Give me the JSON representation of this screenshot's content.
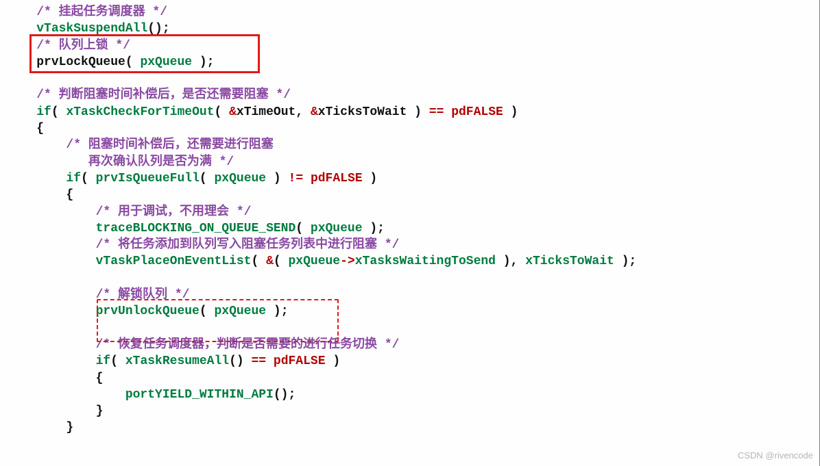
{
  "code": {
    "c1": "/* 挂起任务调度器 */",
    "fn1": "vTaskSuspendAll",
    "p1": "();",
    "c2": "/* 队列上锁 */",
    "ln4a": "prvLockQueue( ",
    "ln4b": "pxQueue",
    "ln4c": " );",
    "c3": "/* 判断阻塞时间补偿后，是否还需要阻塞 */",
    "if": "if",
    "fn2": "xTaskCheckForTimeOut",
    "ln7a": "( ",
    "ln7b": "( ",
    "ln7c": "&",
    "arg1": "xTimeOut",
    "ln7d": ", ",
    "ln7e": "&",
    "arg2": "xTicksToWait",
    "ln7f": " ) ",
    "eq": "==",
    "pdFALSE": "pdFALSE",
    "ln7g": " )",
    "lbrace": "{",
    "rbrace": "}",
    "c4a": "/* 阻塞时间补偿后，还需要进行阻塞",
    "c4b": "   再次确认队列是否为满 */",
    "fn3": "prvIsQueueFull",
    "ln11a": "( ",
    "ln11b": "( ",
    "pxQueue": "pxQueue",
    "ln11c": " ) ",
    "neq": "!=",
    "ln11d": " )",
    "c5": "/* 用于调试，不用理会 */",
    "fn4": "traceBLOCKING_ON_QUEUE_SEND",
    "ln14a": "( ",
    "ln14b": " );",
    "c6": "/* 将任务添加到队列写入阻塞任务列表中进行阻塞 */",
    "fn5": "vTaskPlaceOnEventList",
    "ln16a": "( ",
    "ln16b": "&",
    "ln16c": "( ",
    "arrow": "->",
    "member": "xTasksWaitingToSend",
    "ln16d": " ), ",
    "arg3": "xTicksToWait",
    "ln16e": " );",
    "c7": "/* 解锁队列 */",
    "fn6": "prvUnlockQueue",
    "ln19a": "( ",
    "ln19b": " );",
    "c8": "/* 恢复任务调度器，判断是否需要的进行任务切换 */",
    "fn7": "xTaskResumeAll",
    "ln22a": "( ",
    "ln22b": "() ",
    "ln22c": " )",
    "fn8": "portYIELD_WITHIN_API",
    "ln24a": "();"
  },
  "watermark": "CSDN @rivencode"
}
